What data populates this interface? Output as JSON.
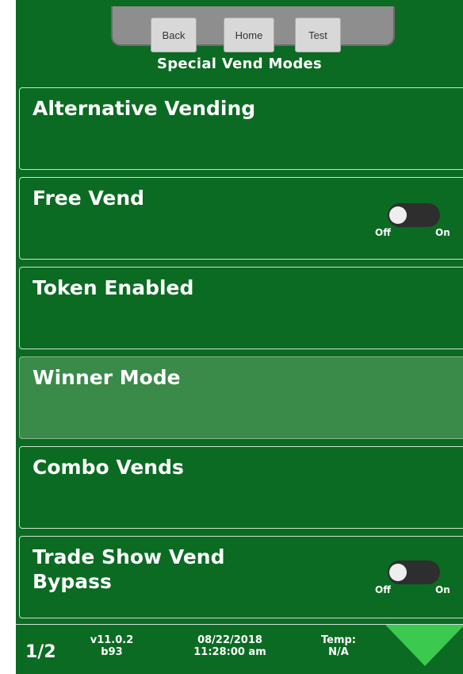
{
  "nav": {
    "back_label": "Back",
    "home_label": "Home",
    "test_label": "Test"
  },
  "page_title": "Special Vend Modes",
  "menu": {
    "items": [
      {
        "label": "Alternative Vending"
      },
      {
        "label": "Free Vend",
        "toggle": {
          "off_label": "Off",
          "on_label": "On",
          "state": "off"
        }
      },
      {
        "label": "Token Enabled"
      },
      {
        "label": "Winner Mode",
        "highlighted": true
      },
      {
        "label": "Combo Vends"
      },
      {
        "label": "Trade Show Vend\nBypass",
        "toggle": {
          "off_label": "Off",
          "on_label": "On",
          "state": "off"
        }
      }
    ]
  },
  "footer": {
    "page_indicator": "1/2",
    "version_line1": "v11.0.2",
    "version_line2": "b93",
    "date": "08/22/2018",
    "time": "11:28:00 am",
    "temp_label": "Temp:",
    "temp_value": "N/A"
  },
  "colors": {
    "background": "#0b6b22",
    "highlight": "#3a8a4a",
    "arrow": "#3cc94f"
  },
  "icons": {
    "next_page": "triangle-down-icon"
  }
}
